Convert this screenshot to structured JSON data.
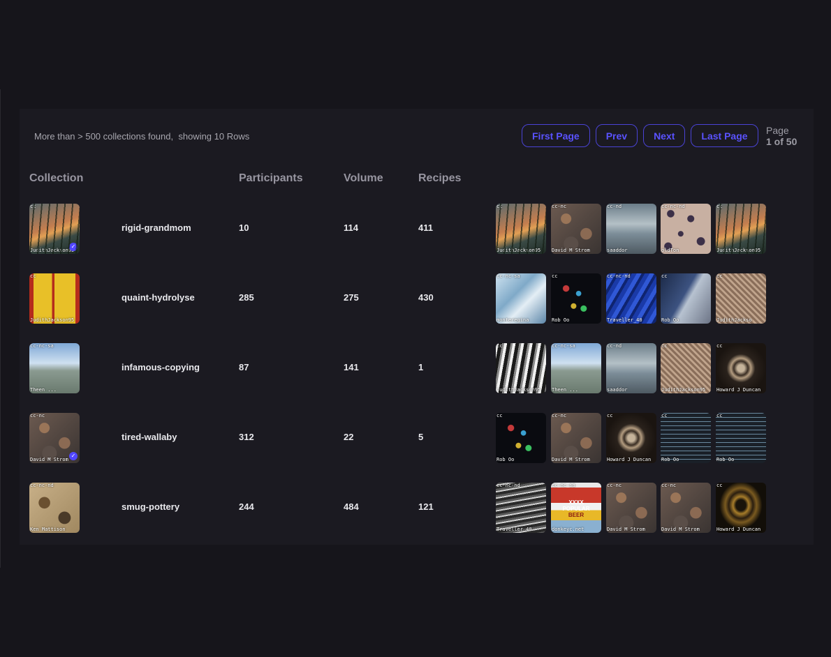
{
  "summary": {
    "prefix": "More than > 500 collections found,",
    "rows": "showing 10 Rows"
  },
  "pager": {
    "first": "First Page",
    "prev": "Prev",
    "next": "Next",
    "last": "Last Page",
    "page_label": "Page",
    "page_value": "1 of 50"
  },
  "headers": {
    "collection": "Collection",
    "participants": "Participants",
    "volume": "Volume",
    "recipes": "Recipes"
  },
  "rows": [
    {
      "name": "rigid-grandmom",
      "participants": "10",
      "volume": "114",
      "recipes": "411",
      "cover": {
        "license": "cc",
        "author": "JudithJackson95",
        "verified": true
      },
      "thumbs": [
        {
          "license": "cc",
          "author": "JudithJackson95"
        },
        {
          "license": "cc-nc",
          "author": "David M Strom"
        },
        {
          "license": "cc-nd",
          "author": "saaddor"
        },
        {
          "license": "cc-nc-nd",
          "author": "oldTon"
        },
        {
          "license": "cc",
          "author": "JudithJackson95"
        }
      ]
    },
    {
      "name": "quaint-hydrolyse",
      "participants": "285",
      "volume": "275",
      "recipes": "430",
      "cover": {
        "license": "cc",
        "author": "JudithJackson95",
        "verified": false
      },
      "thumbs": [
        {
          "license": "cc-nc-sa",
          "author": "monteregina"
        },
        {
          "license": "cc",
          "author": "Rob Oo"
        },
        {
          "license": "cc-nc-nd",
          "author": "Traveller_40"
        },
        {
          "license": "cc",
          "author": "Rob Oo"
        },
        {
          "license": "cc",
          "author": "JudithJackso"
        }
      ]
    },
    {
      "name": "infamous-copying",
      "participants": "87",
      "volume": "141",
      "recipes": "1",
      "cover": {
        "license": "cc-nc-sa",
        "author": "Theen ...",
        "verified": false
      },
      "thumbs": [
        {
          "license": "cc",
          "author": "JudithJackson95"
        },
        {
          "license": "cc-nc-sa",
          "author": "Theen ..."
        },
        {
          "license": "cc-nd",
          "author": "saaddor"
        },
        {
          "license": "cc",
          "author": "JudithJackson95"
        },
        {
          "license": "cc",
          "author": "Howard J Duncan"
        }
      ]
    },
    {
      "name": "tired-wallaby",
      "participants": "312",
      "volume": "22",
      "recipes": "5",
      "cover": {
        "license": "cc-nc",
        "author": "David M Strom",
        "verified": true
      },
      "thumbs": [
        {
          "license": "cc",
          "author": "Rob Oo"
        },
        {
          "license": "cc-nc",
          "author": "David M Strom"
        },
        {
          "license": "cc",
          "author": "Howard J Duncan"
        },
        {
          "license": "cc",
          "author": "Rob Oo"
        },
        {
          "license": "cc",
          "author": "Rob Oo"
        }
      ]
    },
    {
      "name": "smug-pottery",
      "participants": "244",
      "volume": "484",
      "recipes": "121",
      "cover": {
        "license": "cc-nc-nd",
        "author": "Ken Mattison",
        "verified": false
      },
      "thumbs": [
        {
          "license": "cc-nc-nd",
          "author": "Traveller_40"
        },
        {
          "license": "cc-nc-sa",
          "author": "donkeyc.net"
        },
        {
          "license": "cc-nc",
          "author": "David M Strom"
        },
        {
          "license": "cc-nc",
          "author": "David M Strom"
        },
        {
          "license": "cc",
          "author": "Howard J Duncan"
        }
      ]
    }
  ],
  "beer_sign": {
    "line1": "XXXX",
    "line2": "POPULAR",
    "line3": "BEER"
  }
}
